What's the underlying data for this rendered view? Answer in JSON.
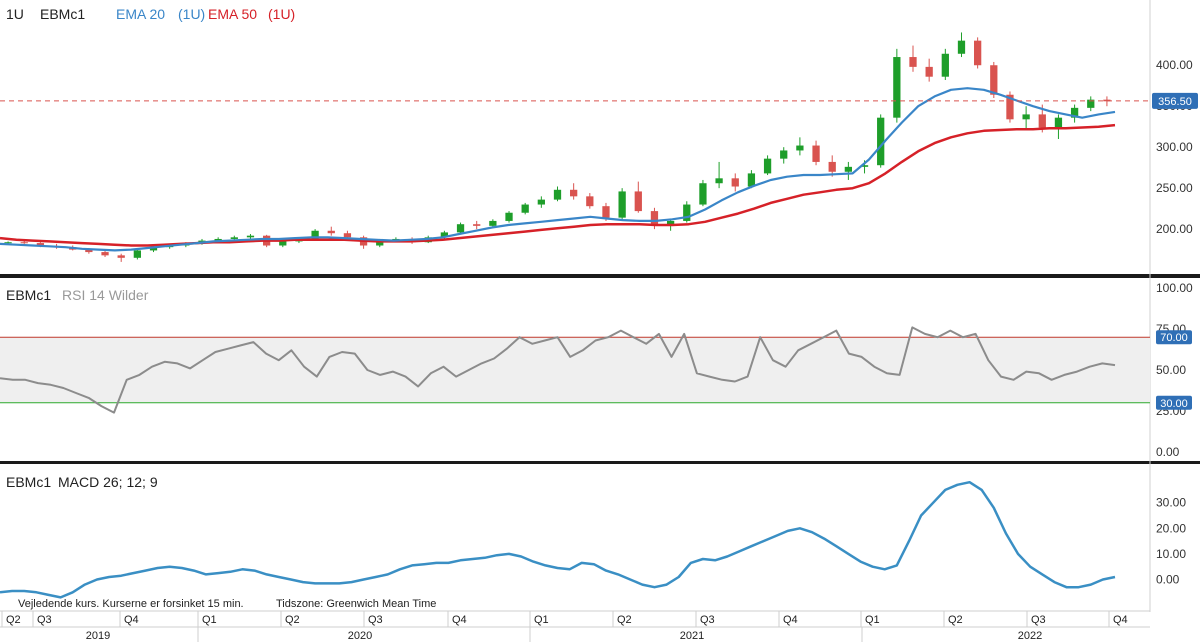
{
  "header": {
    "interval": "1U",
    "symbol": "EBMc1",
    "ema20_label": "EMA 20",
    "ema20_interval": "(1U)",
    "ema50_label": "EMA 50",
    "ema50_interval": "(1U)"
  },
  "rsi_panel": {
    "symbol": "EBMc1",
    "indicator": "RSI 14 Wilder"
  },
  "macd_panel": {
    "symbol": "EBMc1",
    "indicator": "MACD 26; 12; 9"
  },
  "footer": {
    "disclaimer": "Vejledende kurs. Kurserne er forsinket 15 min.",
    "timezone": "Tidszone: Greenwich Mean Time"
  },
  "colors": {
    "up": "#1e9e2a",
    "down": "#d9534f",
    "ema20": "#3a86c8",
    "ema50": "#d62128",
    "rsi": "#8c8c8c",
    "macd": "#3a8fc4",
    "rsi_upper": "#c0392b",
    "rsi_lower": "#2eaa2e",
    "badge": "#2f6fb6"
  },
  "chart_data": [
    {
      "type": "candlestick",
      "title": "EBMc1",
      "interval": "1U",
      "y_ticks": [
        "400.00",
        "350.00",
        "300.00",
        "250.00",
        "200.00"
      ],
      "ylim": [
        155,
        443
      ],
      "last_price": 356.5,
      "last_price_label": "356.50",
      "series": [
        {
          "name": "EMA 20 (1U)",
          "values": [
            182,
            181,
            180,
            179,
            178,
            176,
            175,
            174,
            175,
            177,
            179,
            181,
            183,
            185,
            186,
            187,
            188,
            188,
            189,
            190,
            190,
            189,
            188,
            187,
            186,
            187,
            188,
            190,
            194,
            198,
            202,
            205,
            207,
            209,
            211,
            213,
            215,
            213,
            211,
            210,
            210,
            212,
            215,
            224,
            235,
            245,
            253,
            260,
            264,
            266,
            266,
            267,
            268,
            285,
            308,
            330,
            350,
            362,
            370,
            372,
            370,
            364,
            357,
            350,
            344,
            340,
            336,
            340,
            343
          ]
        },
        {
          "name": "EMA 50 (1U)",
          "values": [
            189,
            187,
            186,
            185,
            184,
            183,
            182,
            181,
            180,
            180,
            181,
            182,
            183,
            184,
            184,
            185,
            186,
            186,
            187,
            187,
            187,
            187,
            186,
            185,
            185,
            185,
            186,
            187,
            189,
            191,
            193,
            195,
            197,
            199,
            201,
            203,
            205,
            206,
            206,
            206,
            205,
            205,
            206,
            209,
            214,
            219,
            225,
            232,
            237,
            242,
            245,
            248,
            250,
            256,
            268,
            282,
            295,
            305,
            312,
            317,
            320,
            321,
            322,
            322,
            323,
            323,
            324,
            325,
            327
          ]
        }
      ],
      "candles_note": "weekly OHLC series shown as red/green candlesticks",
      "ohlc": [
        [
          183,
          185,
          181,
          184
        ],
        [
          184,
          186,
          182,
          183
        ],
        [
          183,
          184,
          178,
          179
        ],
        [
          179,
          182,
          176,
          178
        ],
        [
          178,
          180,
          174,
          175
        ],
        [
          175,
          177,
          170,
          172
        ],
        [
          172,
          174,
          166,
          168
        ],
        [
          168,
          170,
          160,
          165
        ],
        [
          165,
          176,
          163,
          174
        ],
        [
          174,
          180,
          172,
          178
        ],
        [
          178,
          182,
          176,
          180
        ],
        [
          180,
          184,
          178,
          183
        ],
        [
          183,
          188,
          181,
          186
        ],
        [
          186,
          190,
          184,
          188
        ],
        [
          188,
          192,
          185,
          190
        ],
        [
          190,
          194,
          187,
          192
        ],
        [
          192,
          193,
          178,
          180
        ],
        [
          180,
          186,
          178,
          185
        ],
        [
          185,
          190,
          183,
          188
        ],
        [
          188,
          200,
          186,
          198
        ],
        [
          198,
          203,
          192,
          195
        ],
        [
          195,
          198,
          186,
          190
        ],
        [
          190,
          192,
          176,
          180
        ],
        [
          180,
          188,
          178,
          186
        ],
        [
          186,
          190,
          184,
          188
        ],
        [
          188,
          190,
          182,
          184
        ],
        [
          184,
          192,
          183,
          190
        ],
        [
          190,
          198,
          188,
          196
        ],
        [
          196,
          208,
          195,
          206
        ],
        [
          206,
          210,
          200,
          204
        ],
        [
          204,
          212,
          202,
          210
        ],
        [
          210,
          222,
          208,
          220
        ],
        [
          220,
          232,
          218,
          230
        ],
        [
          230,
          240,
          226,
          236
        ],
        [
          236,
          252,
          234,
          248
        ],
        [
          248,
          256,
          236,
          240
        ],
        [
          240,
          244,
          225,
          228
        ],
        [
          228,
          232,
          210,
          214
        ],
        [
          214,
          250,
          212,
          246
        ],
        [
          246,
          258,
          220,
          222
        ],
        [
          222,
          226,
          200,
          206
        ],
        [
          206,
          212,
          198,
          210
        ],
        [
          210,
          234,
          208,
          230
        ],
        [
          230,
          260,
          228,
          256
        ],
        [
          256,
          282,
          250,
          262
        ],
        [
          262,
          268,
          246,
          252
        ],
        [
          252,
          272,
          250,
          268
        ],
        [
          268,
          290,
          266,
          286
        ],
        [
          286,
          300,
          280,
          296
        ],
        [
          296,
          312,
          290,
          302
        ],
        [
          302,
          308,
          278,
          282
        ],
        [
          282,
          290,
          264,
          270
        ],
        [
          270,
          282,
          260,
          276
        ],
        [
          276,
          284,
          268,
          278
        ],
        [
          278,
          340,
          275,
          336
        ],
        [
          336,
          420,
          330,
          410
        ],
        [
          410,
          424,
          392,
          398
        ],
        [
          398,
          408,
          380,
          386
        ],
        [
          386,
          420,
          382,
          414
        ],
        [
          414,
          440,
          410,
          430
        ],
        [
          430,
          434,
          396,
          400
        ],
        [
          400,
          404,
          360,
          364
        ],
        [
          364,
          368,
          330,
          334
        ],
        [
          334,
          350,
          322,
          340
        ],
        [
          340,
          352,
          318,
          324
        ],
        [
          324,
          340,
          310,
          336
        ],
        [
          336,
          352,
          330,
          348
        ],
        [
          348,
          362,
          344,
          358
        ],
        [
          358,
          362,
          350,
          356
        ]
      ]
    },
    {
      "type": "line",
      "title": "EBMc1 RSI 14 Wilder",
      "y_ticks": [
        "100.00",
        "75.00",
        "50.00",
        "25.00",
        "0.00"
      ],
      "ylim": [
        0,
        100
      ],
      "bands": [
        {
          "label": "70.00",
          "value": 70
        },
        {
          "label": "30.00",
          "value": 30
        }
      ],
      "series": [
        {
          "name": "RSI 14 Wilder",
          "values": [
            45,
            44,
            44,
            42,
            41,
            39,
            36,
            33,
            28,
            24,
            44,
            47,
            52,
            55,
            54,
            51,
            56,
            61,
            63,
            65,
            67,
            60,
            56,
            62,
            52,
            46,
            58,
            61,
            60,
            50,
            47,
            49,
            46,
            40,
            48,
            52,
            46,
            50,
            54,
            57,
            63,
            70,
            66,
            68,
            70,
            58,
            62,
            68,
            70,
            74,
            70,
            66,
            72,
            58,
            72,
            48,
            46,
            44,
            43,
            46,
            70,
            56,
            52,
            62,
            66,
            70,
            74,
            60,
            58,
            52,
            48,
            47,
            76,
            72,
            70,
            74,
            70,
            72,
            56,
            46,
            44,
            49,
            48,
            44,
            47,
            49,
            52,
            54,
            53
          ]
        }
      ]
    },
    {
      "type": "line",
      "title": "EBMc1 MACD 26; 12; 9",
      "y_ticks": [
        "30.00",
        "20.00",
        "10.00",
        "0.00"
      ],
      "ylim": [
        -8,
        42
      ],
      "series": [
        {
          "name": "MACD 26; 12; 9",
          "values": [
            -5,
            -4.5,
            -4.5,
            -5,
            -6,
            -7,
            -5,
            -2,
            0,
            1,
            1.5,
            2.5,
            3.5,
            4.5,
            5,
            4.5,
            3.5,
            2,
            2.5,
            3,
            4,
            3.5,
            2,
            1,
            0,
            -1,
            -1.5,
            -1.5,
            -1.5,
            -1,
            0,
            1,
            2,
            4,
            5.5,
            6,
            6.5,
            6.5,
            7.5,
            8,
            8.5,
            9.5,
            10,
            9,
            7,
            5.5,
            4.5,
            4,
            6.5,
            6,
            3.5,
            2,
            0,
            -2,
            -3,
            -2,
            1,
            6.5,
            8,
            7.5,
            9,
            11,
            13,
            15,
            17,
            19,
            20,
            18.5,
            16,
            13,
            10,
            7,
            5,
            4,
            5.5,
            15,
            25,
            30,
            35,
            37,
            38,
            35,
            28,
            18,
            10,
            5,
            2,
            -1,
            -3,
            -3,
            -2,
            0,
            1
          ]
        }
      ]
    }
  ],
  "time_axis": {
    "quarters": [
      "Q2",
      "Q3",
      "Q4",
      "Q1",
      "Q2",
      "Q3",
      "Q4",
      "Q1",
      "Q2",
      "Q3",
      "Q4",
      "Q1",
      "Q2",
      "Q3",
      "Q4"
    ],
    "years": [
      "2019",
      "2020",
      "2021",
      "2022"
    ]
  }
}
